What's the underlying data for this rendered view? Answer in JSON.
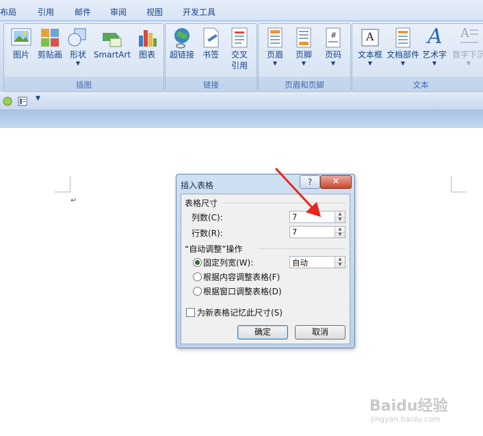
{
  "tabs": [
    {
      "label": "布局"
    },
    {
      "label": "引用"
    },
    {
      "label": "邮件"
    },
    {
      "label": "审阅"
    },
    {
      "label": "视图"
    },
    {
      "label": "开发工具"
    }
  ],
  "groups": {
    "illustrations": {
      "label": "插图",
      "buttons": [
        {
          "label": "图片",
          "icon": "picture-icon"
        },
        {
          "label": "剪贴画",
          "icon": "clipart-icon"
        },
        {
          "label": "形状",
          "icon": "shapes-icon"
        },
        {
          "label": "SmartArt",
          "icon": "smartart-icon"
        },
        {
          "label": "图表",
          "icon": "chart-icon"
        }
      ]
    },
    "links": {
      "label": "链接",
      "buttons": [
        {
          "label": "超链接",
          "icon": "hyperlink-icon"
        },
        {
          "label": "书签",
          "icon": "bookmark-icon"
        },
        {
          "label": "交叉",
          "label2": "引用",
          "icon": "cross-reference-icon"
        }
      ]
    },
    "header_footer": {
      "label": "页眉和页脚",
      "buttons": [
        {
          "label": "页眉",
          "icon": "header-icon"
        },
        {
          "label": "页脚",
          "icon": "footer-icon"
        },
        {
          "label": "页码",
          "icon": "page-number-icon",
          "glyph": "#"
        }
      ]
    },
    "text": {
      "label": "文本",
      "buttons": [
        {
          "label": "文本框",
          "icon": "textbox-icon",
          "glyph": "A"
        },
        {
          "label": "文档部件",
          "icon": "quick-parts-icon"
        },
        {
          "label": "艺术字",
          "icon": "wordart-icon",
          "glyph": "A"
        },
        {
          "label": "首字下沉",
          "icon": "drop-cap-icon",
          "glyph": "A"
        }
      ]
    }
  },
  "document": {
    "paragraph_mark": "↵"
  },
  "dialog": {
    "title": "插入表格",
    "help_glyph": "?",
    "close_glyph": "✕",
    "section_size": "表格尺寸",
    "columns_label": "列数(C):",
    "columns_value": "7",
    "rows_label": "行数(R):",
    "rows_value": "7",
    "section_autofit": "“自动调整”操作",
    "fixed_width_label": "固定列宽(W):",
    "fixed_width_value": "自动",
    "autofit_content_label": "根据内容调整表格(F)",
    "autofit_window_label": "根据窗口调整表格(D)",
    "remember_label": "为新表格记忆此尺寸(S)",
    "ok_label": "确定",
    "cancel_label": "取消"
  },
  "watermark": {
    "text": "Baidu经验",
    "url": "jingyan.baidu.com"
  },
  "colors": {
    "annotation_arrow": "#e8261c",
    "ribbon_text": "#15428b"
  }
}
